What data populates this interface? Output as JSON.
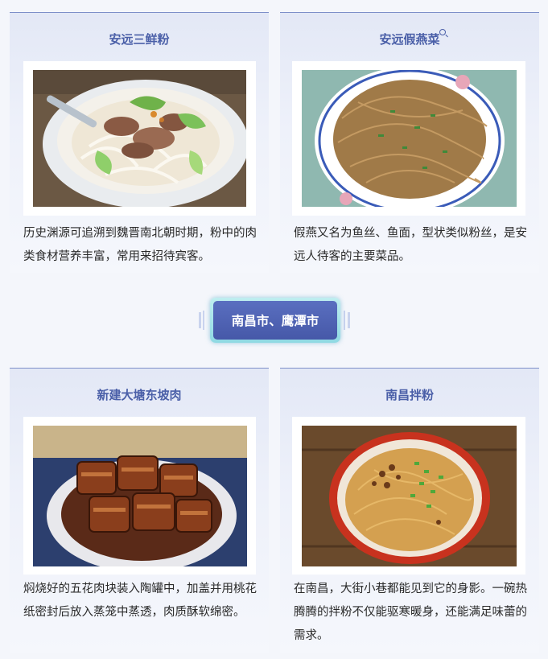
{
  "cards": [
    {
      "title": "安远三鲜粉",
      "description": "历史渊源可追溯到魏晋南北朝时期，粉中的肉类食材营养丰富，常用来招待宾客。"
    },
    {
      "title": "安远假燕菜",
      "description": "假燕又名为鱼丝、鱼面，型状类似粉丝，是安远人待客的主要菜品。"
    },
    {
      "title": "新建大塘东坡肉",
      "description": "焖烧好的五花肉块装入陶罐中，加盖并用桃花纸密封后放入蒸笼中蒸透，肉质酥软绵密。"
    },
    {
      "title": "南昌拌粉",
      "description": "在南昌，大街小巷都能见到它的身影。一碗热腾腾的拌粉不仅能驱寒暖身，还能满足味蕾的需求。"
    }
  ],
  "divider": {
    "label": "南昌市、鹰潭市"
  },
  "colors": {
    "title": "#4a5fa8",
    "card_border": "#7d8fc9",
    "badge": "#4f63b2",
    "badge_glow": "#8fd9e3"
  },
  "icons": [
    "search-icon"
  ]
}
